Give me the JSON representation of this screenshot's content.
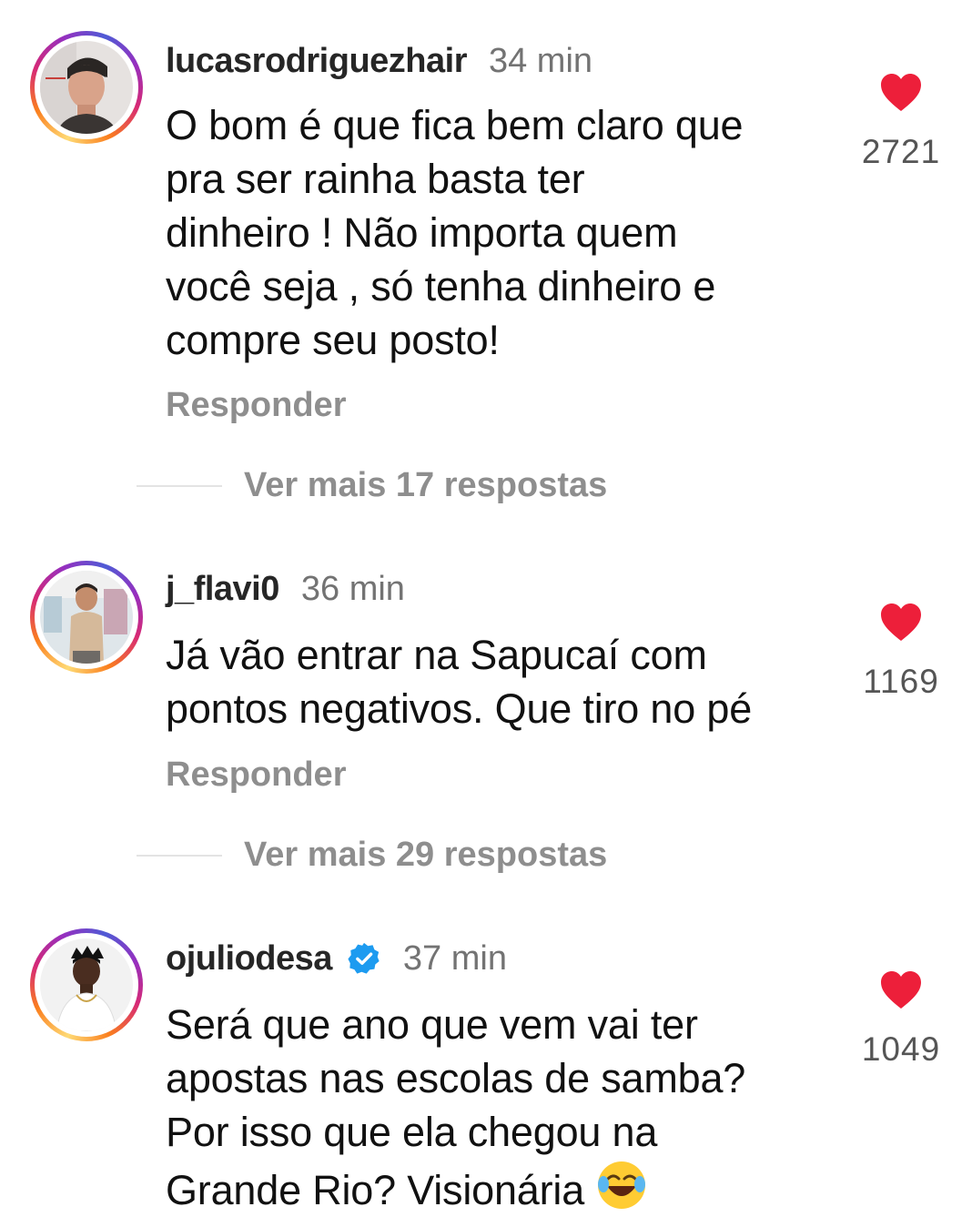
{
  "comments": [
    {
      "username": "lucasrodriguezhair",
      "verified": false,
      "time": "34 min",
      "lines": [
        "O bom é que fica bem claro que",
        "pra ser rainha basta ter",
        "dinheiro ! Não importa quem",
        "você seja , só tenha dinheiro e",
        "compre seu posto!"
      ],
      "likes": "2721",
      "reply_label": "Responder",
      "more_replies": "Ver mais 17 respostas",
      "avatar_icon": "profile-photo-man"
    },
    {
      "username": "j_flavi0",
      "verified": false,
      "time": "36 min",
      "lines": [
        "Já vão entrar na Sapucaí com",
        "pontos negativos. Que tiro no pé"
      ],
      "likes": "1169",
      "reply_label": "Responder",
      "more_replies": "Ver mais 29 respostas",
      "avatar_icon": "profile-photo-man"
    },
    {
      "username": "ojuliodesa",
      "verified": true,
      "time": "37 min",
      "lines": [
        "Será que ano que vem vai ter",
        "apostas nas escolas de samba?",
        "Por isso que ela chegou na",
        "Grande Rio? Visionária"
      ],
      "emoji": "tears-of-joy-emoji",
      "likes": "1049",
      "avatar_icon": "profile-photo-man"
    }
  ],
  "colors": {
    "like_heart": "#ed1f3a",
    "verified_badge": "#1d9bf0",
    "meta_text": "#8e8e8e"
  }
}
